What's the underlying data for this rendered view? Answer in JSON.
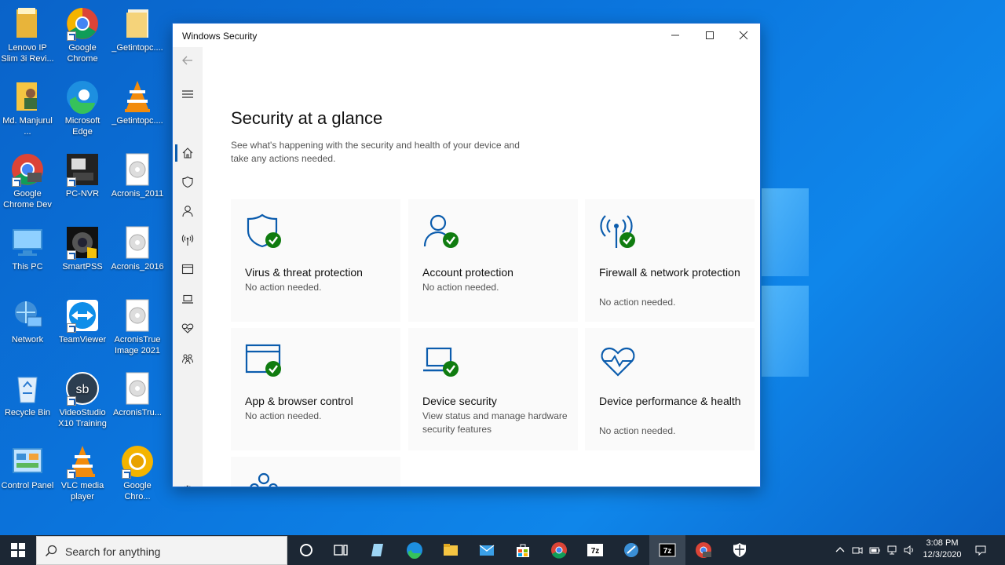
{
  "desktop": {
    "icons": [
      {
        "label": "Lenovo IP Slim 3i Revi...",
        "icon": "folder-icon"
      },
      {
        "label": "Google Chrome",
        "icon": "chrome-icon"
      },
      {
        "label": "_Getintopc....",
        "icon": "folder-icon"
      },
      {
        "label": "Md. Manjurul ...",
        "icon": "user-folder-icon"
      },
      {
        "label": "Microsoft Edge",
        "icon": "edge-icon"
      },
      {
        "label": "_Getintopc....",
        "icon": "vlc-icon"
      },
      {
        "label": "Google Chrome Dev",
        "icon": "chrome-dev-icon"
      },
      {
        "label": "PC-NVR",
        "icon": "nvr-icon"
      },
      {
        "label": "Acronis_2011",
        "icon": "disc-icon"
      },
      {
        "label": "This PC",
        "icon": "computer-icon"
      },
      {
        "label": "SmartPSS",
        "icon": "smartpss-icon"
      },
      {
        "label": "Acronis_2016",
        "icon": "disc-icon"
      },
      {
        "label": "Network",
        "icon": "network-icon"
      },
      {
        "label": "TeamViewer",
        "icon": "teamviewer-icon"
      },
      {
        "label": "AcronisTrue Image 2021",
        "icon": "disc-icon"
      },
      {
        "label": "Recycle Bin",
        "icon": "recycle-bin-icon"
      },
      {
        "label": "VideoStudio X10 Training",
        "icon": "videostudio-icon"
      },
      {
        "label": "AcronisTru...",
        "icon": "disc-icon"
      },
      {
        "label": "Control Panel",
        "icon": "control-panel-icon"
      },
      {
        "label": "VLC media player",
        "icon": "vlc-icon"
      },
      {
        "label": "Google Chro...",
        "icon": "chrome-canary-icon"
      }
    ]
  },
  "window": {
    "title": "Windows Security",
    "page_title": "Security at a glance",
    "page_subtitle": "See what's happening with the security and health of your device and take any actions needed.",
    "nav": [
      {
        "name": "back",
        "icon": "back-arrow-icon"
      },
      {
        "name": "menu",
        "icon": "hamburger-menu-icon"
      },
      {
        "name": "home",
        "icon": "home-icon",
        "active": true
      },
      {
        "name": "virus-protection",
        "icon": "shield-icon"
      },
      {
        "name": "account-protection",
        "icon": "person-icon"
      },
      {
        "name": "firewall",
        "icon": "antenna-icon"
      },
      {
        "name": "app-browser",
        "icon": "browser-window-icon"
      },
      {
        "name": "device-security",
        "icon": "laptop-icon"
      },
      {
        "name": "device-performance",
        "icon": "heart-pulse-icon"
      },
      {
        "name": "family-options",
        "icon": "family-icon"
      },
      {
        "name": "settings",
        "icon": "gear-icon"
      }
    ],
    "tiles": [
      {
        "name": "Virus & threat protection",
        "status": "No action needed.",
        "icon": "shield-check-icon"
      },
      {
        "name": "Account protection",
        "status": "No action needed.",
        "icon": "person-check-icon"
      },
      {
        "name": "Firewall & network protection",
        "status": "No action needed.",
        "icon": "antenna-check-icon"
      },
      {
        "name": "App & browser control",
        "status": "No action needed.",
        "icon": "browser-check-icon"
      },
      {
        "name": "Device security",
        "status": "View status and manage hardware security features",
        "icon": "laptop-check-icon"
      },
      {
        "name": "Device performance & health",
        "status": "No action needed.",
        "icon": "heart-pulse-icon"
      },
      {
        "name": "",
        "status": "",
        "icon": "family-icon"
      }
    ]
  },
  "taskbar": {
    "search_placeholder": "Search for anything",
    "apps": [
      "task-view-icon",
      "cortana-icon",
      "notes-icon",
      "edge-icon",
      "file-explorer-icon",
      "mail-icon",
      "store-icon",
      "chrome-icon",
      "7zip-icon",
      "app-icon",
      "7zip-icon",
      "chrome-dev-icon",
      "windows-security-icon"
    ],
    "time": "3:08 PM",
    "date": "12/3/2020"
  },
  "colors": {
    "accent": "#0b5cad",
    "check": "#107c10",
    "desktop": "#0b75dd",
    "taskbar": "#1c2734"
  }
}
